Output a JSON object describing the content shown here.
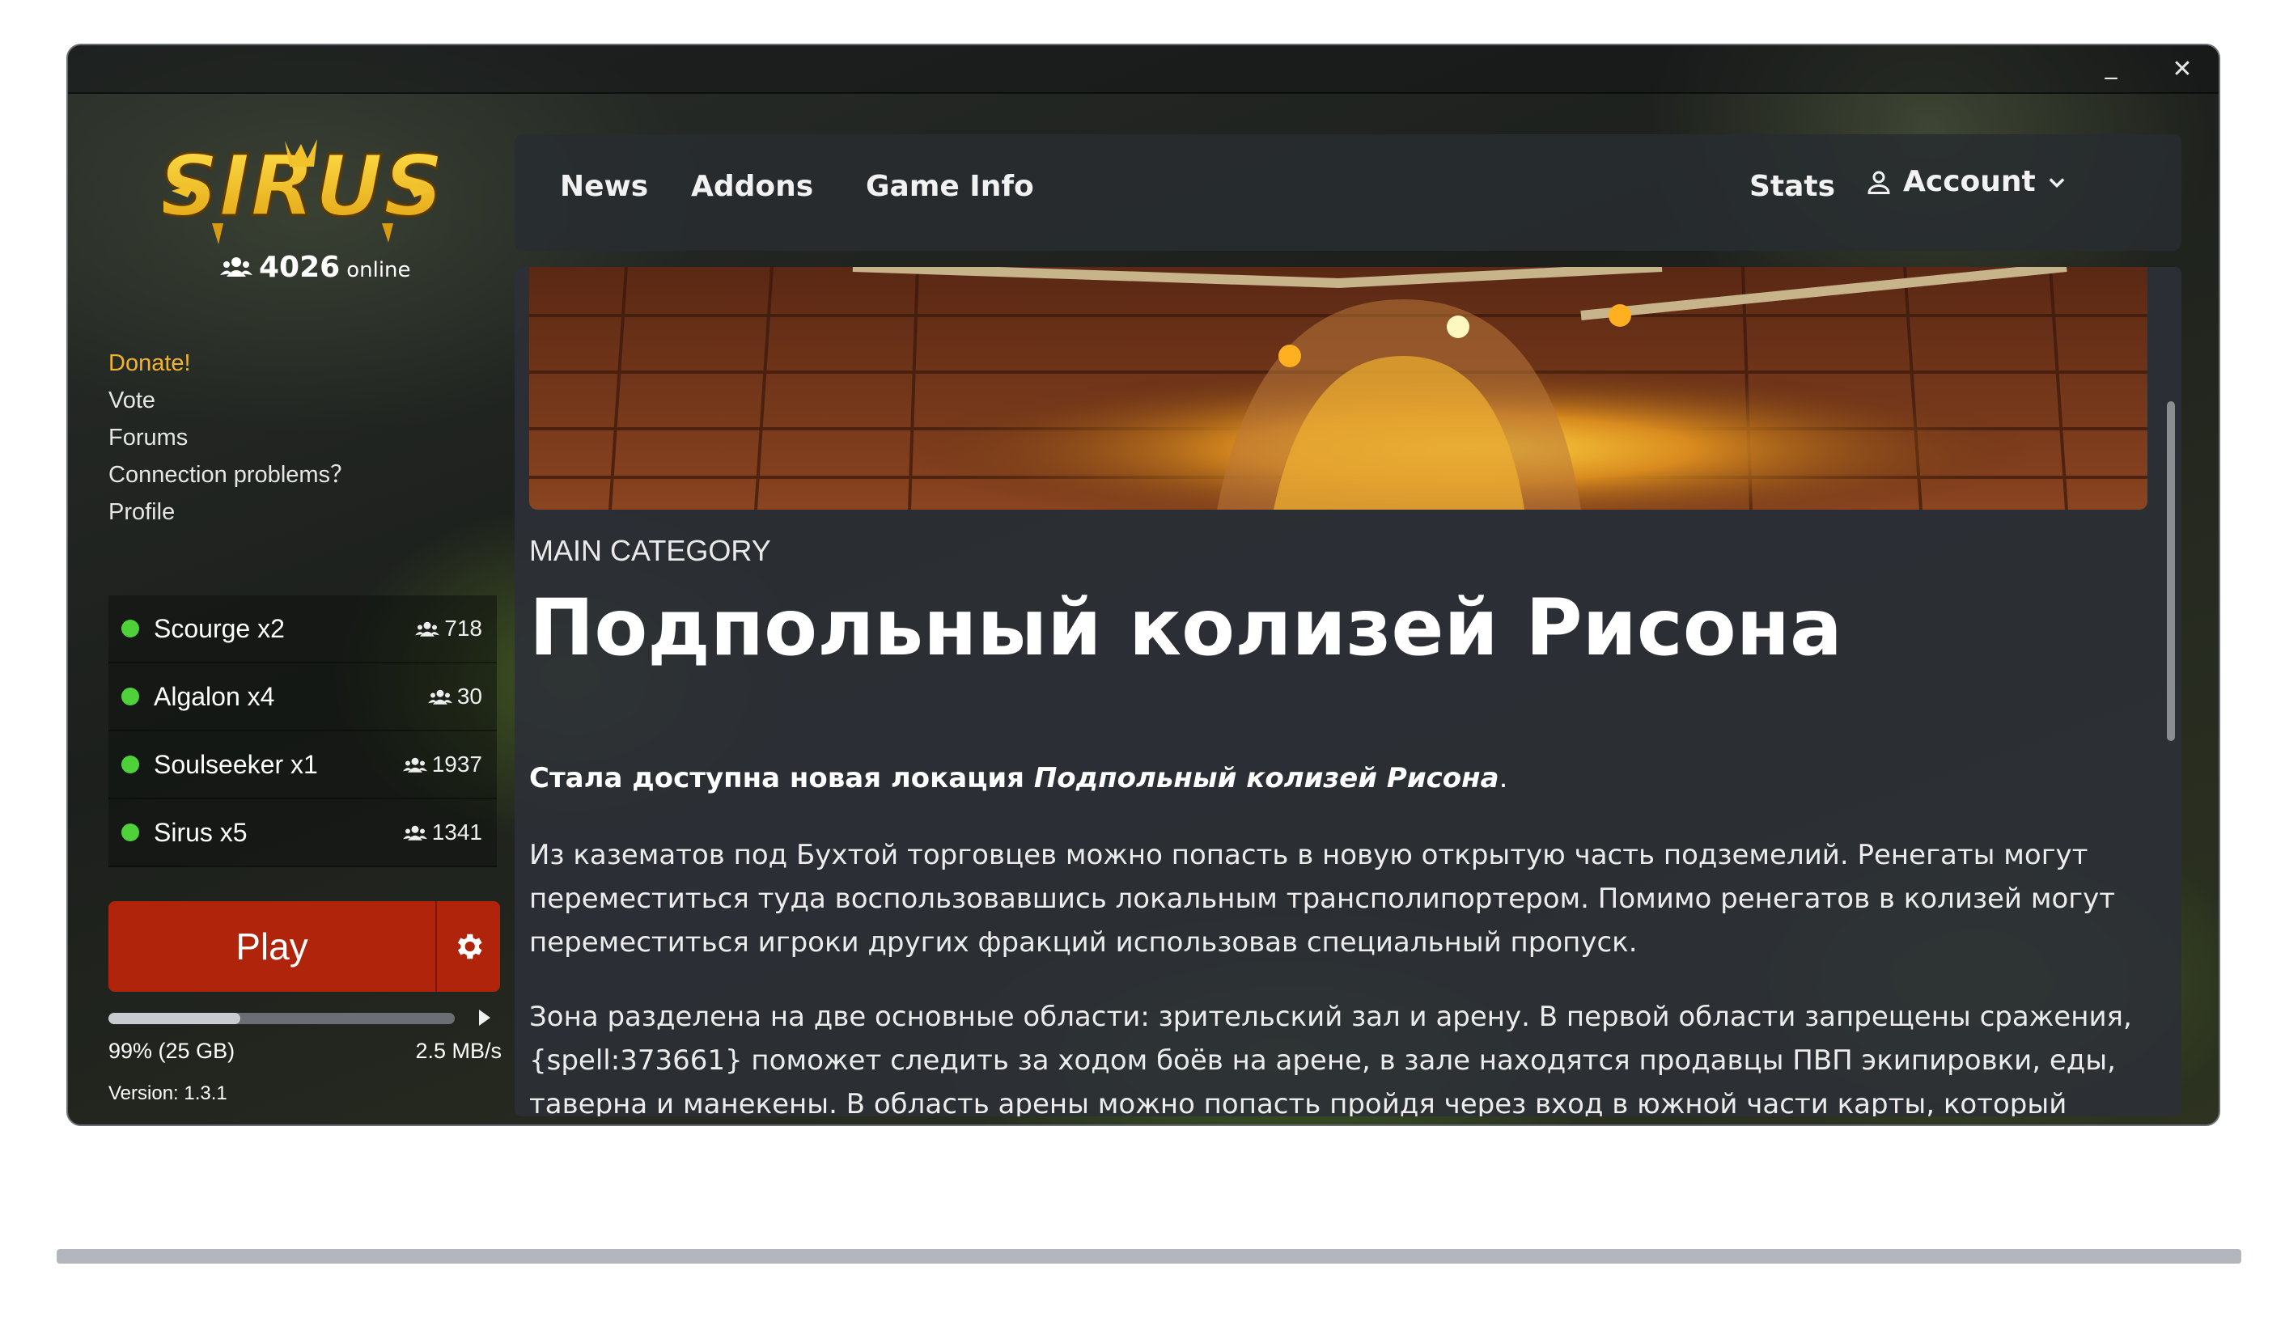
{
  "window": {
    "minimize_glyph": "_",
    "close_glyph": "✕"
  },
  "sidebar": {
    "logo_text": "SIRUS",
    "online_count": "4026",
    "online_label": "online",
    "links": [
      {
        "label": "Donate!"
      },
      {
        "label": "Vote"
      },
      {
        "label": "Forums"
      },
      {
        "label": "Connection problems？"
      },
      {
        "label": "Profile"
      }
    ],
    "servers": [
      {
        "name": "Scourge x2",
        "players": "718",
        "status_color": "#4fd13a"
      },
      {
        "name": "Algalon x4",
        "players": "30",
        "status_color": "#4fd13a"
      },
      {
        "name": "Soulseeker x1",
        "players": "1937",
        "status_color": "#4fd13a"
      },
      {
        "name": "Sirus x5",
        "players": "1341",
        "status_color": "#4fd13a"
      }
    ],
    "play_label": "Play",
    "download": {
      "progress_fraction": 0.38,
      "size_text": "99% (25 GB)",
      "speed_text": "2.5 MB/s"
    },
    "version_text": "Version: 1.3.1"
  },
  "nav": {
    "news": "News",
    "addons": "Addons",
    "game_info": "Game Info",
    "stats": "Stats",
    "account": "Account"
  },
  "article": {
    "category": "MAIN CATEGORY",
    "title": "Подпольный колизей Рисона",
    "lead_bold": "Стала доступна новая локация ",
    "lead_italic": "Подпольный колизей Рисона",
    "lead_end": ".",
    "paragraph1": "Из казематов под Бухтой торговцев можно попасть в новую открытую часть подземелий. Ренегаты могут переместиться туда воспользовавшись локальным трансполипортером. Помимо ренегатов в колизей могут переместиться игроки других фракций использовав специальный пропуск.",
    "paragraph2": "Зона разделена на две основные области: зрительский зал и арену. В первой области запрещены сражения, {spell:373661} поможет следить за ходом боёв на арене, в зале находятся продавцы ПВП экипировки, еды, таверна и манекены. В область арены можно попасть пройдя через вход в южной части карты, который"
  },
  "colors": {
    "accent_donate": "#f3b32b",
    "play_button": "#b0240c",
    "online_dot": "#4fd13a"
  }
}
